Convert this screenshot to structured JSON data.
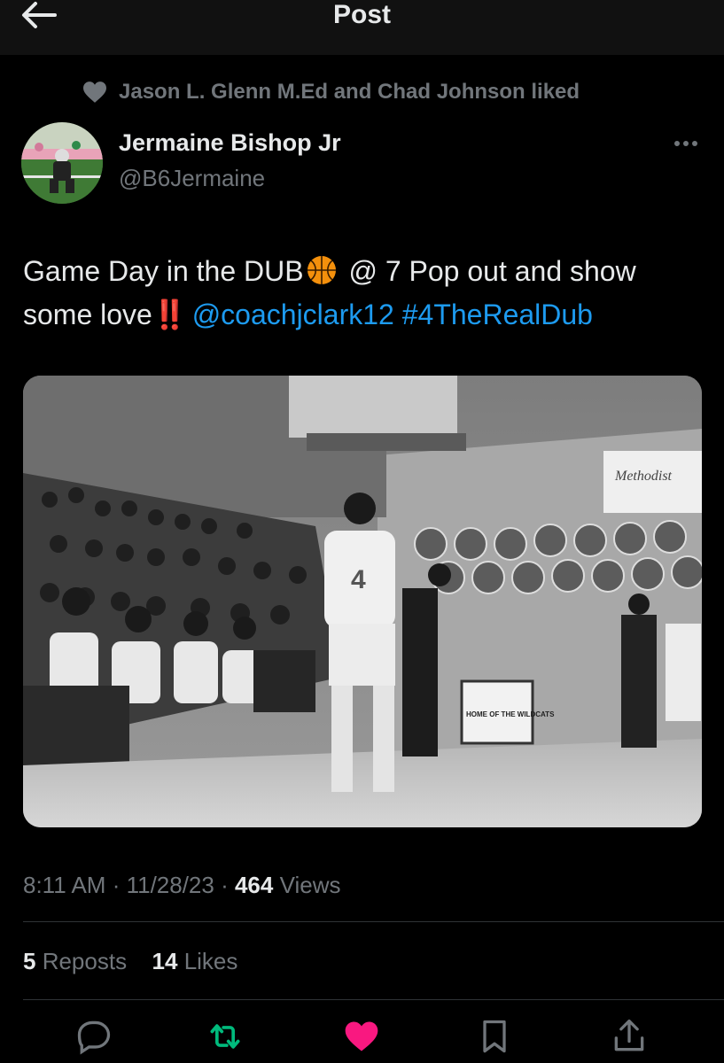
{
  "header": {
    "title": "Post",
    "back_icon": "arrow-left-icon"
  },
  "social_context": {
    "text": "Jason L. Glenn M.Ed and Chad Johnson liked",
    "icon": "heart-icon"
  },
  "author": {
    "name": "Jermaine Bishop Jr",
    "handle": "@B6Jermaine"
  },
  "tweet": {
    "text_part1": "Game Day in the DUB",
    "text_part2": " @ 7 Pop out and show some love",
    "bang": "‼️",
    "mention": "@coachjclark12",
    "hashtag": "#4TheRealDub"
  },
  "meta": {
    "time": "8:11 AM",
    "sep1": " · ",
    "date": "11/28/23",
    "sep2": " · ",
    "views_count": "464",
    "views_label": " Views"
  },
  "stats": {
    "reposts_count": "5",
    "reposts_label": " Reposts",
    "likes_count": "14",
    "likes_label": " Likes"
  },
  "photo_text": {
    "sponsor": "Methodist",
    "banner": "HOME OF THE WILDCATS",
    "jersey": "4"
  },
  "colors": {
    "link": "#1d9bf0",
    "repost": "#00ba7c",
    "like": "#f91880",
    "muted": "#71767b"
  }
}
